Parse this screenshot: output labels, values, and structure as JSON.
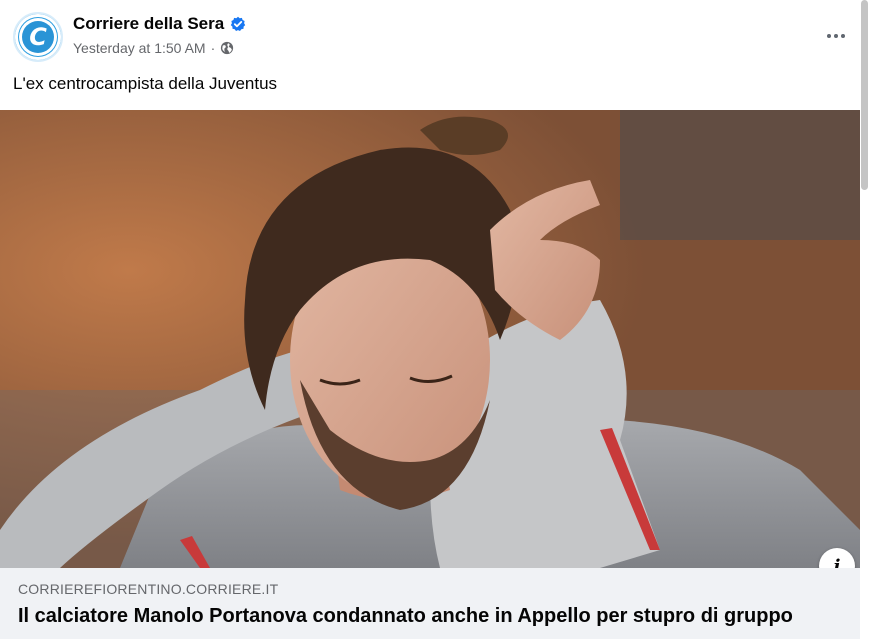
{
  "post": {
    "page_name": "Corriere della Sera",
    "avatar_letter": "C",
    "timestamp": "Yesterday at 1:50 AM",
    "separator": "·",
    "caption": "L'ex centrocampista della Juventus",
    "audience_icon": "globe-icon",
    "verified_icon": "verified-badge-icon",
    "more_icon": "more-options-icon"
  },
  "link_preview": {
    "domain": "CORRIEREFIORENTINO.CORRIERE.IT",
    "title": "Il calciatore Manolo Portanova condannato anche in Appello per stupro di gruppo",
    "info_icon": "info-icon",
    "info_label": "i"
  },
  "colors": {
    "accent": "#1877f2",
    "avatar_bg": "#2a94d6",
    "footer_bg": "#f0f2f5",
    "secondary_text": "#65676b"
  }
}
